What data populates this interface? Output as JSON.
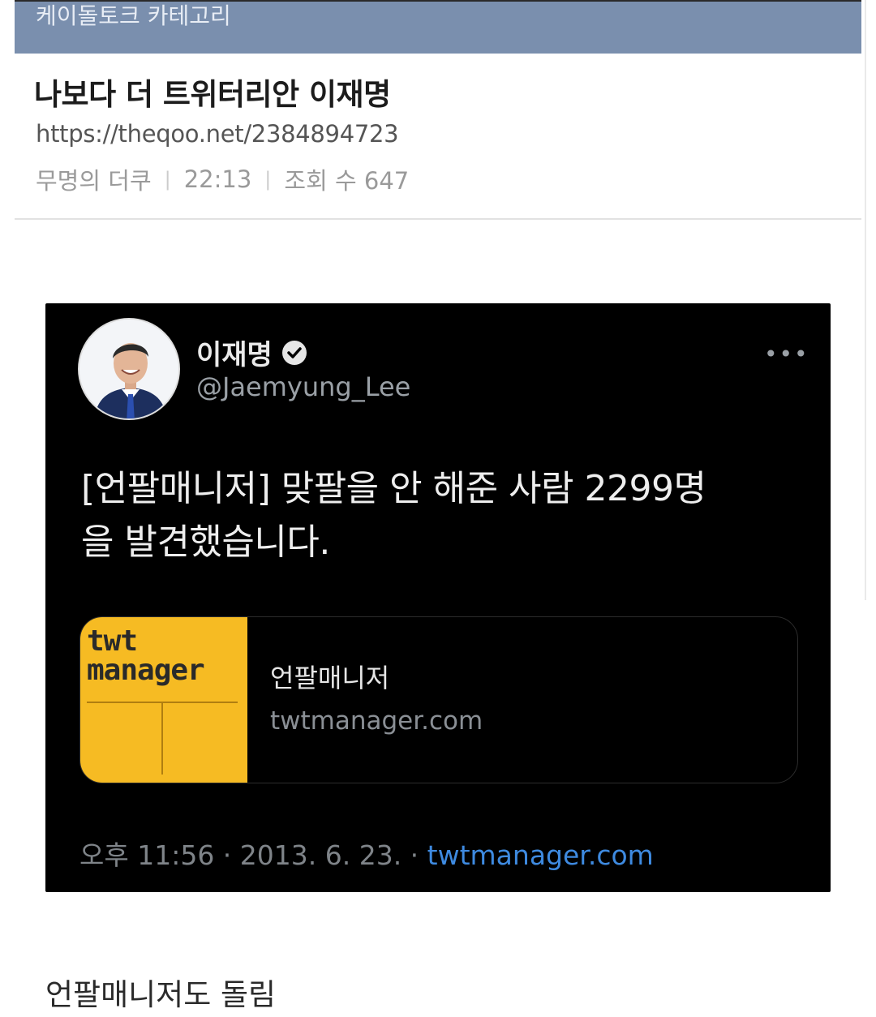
{
  "category_bar": {
    "label": "케이돌토크 카테고리"
  },
  "post": {
    "title": "나보다 더 트위터리안 이재명",
    "url": "https://theqoo.net/2384894723",
    "author": "무명의 더쿠",
    "time": "22:13",
    "views": "조회 수 647"
  },
  "tweet": {
    "author_name": "이재명",
    "handle": "@Jaemyung_Lee",
    "more_icon": "more-dots-icon",
    "text_line1": "[언팔매니저] 맞팔을 안 해준 사람 2299명",
    "text_line2": "을 발견했습니다.",
    "card": {
      "thumb_text_line1": "twt",
      "thumb_text_line2": "manager",
      "title": "언팔매니저",
      "domain": "twtmanager.com"
    },
    "timestamp": "오후 11:56 · 2013. 6. 23. · ",
    "source": "twtmanager.com"
  },
  "caption": "언팔매니저도 돌림",
  "colors": {
    "category_bar": "#7a8fae",
    "tweet_bg": "#000000",
    "card_thumb": "#f6bb23",
    "link_blue": "#3e8ae0"
  }
}
